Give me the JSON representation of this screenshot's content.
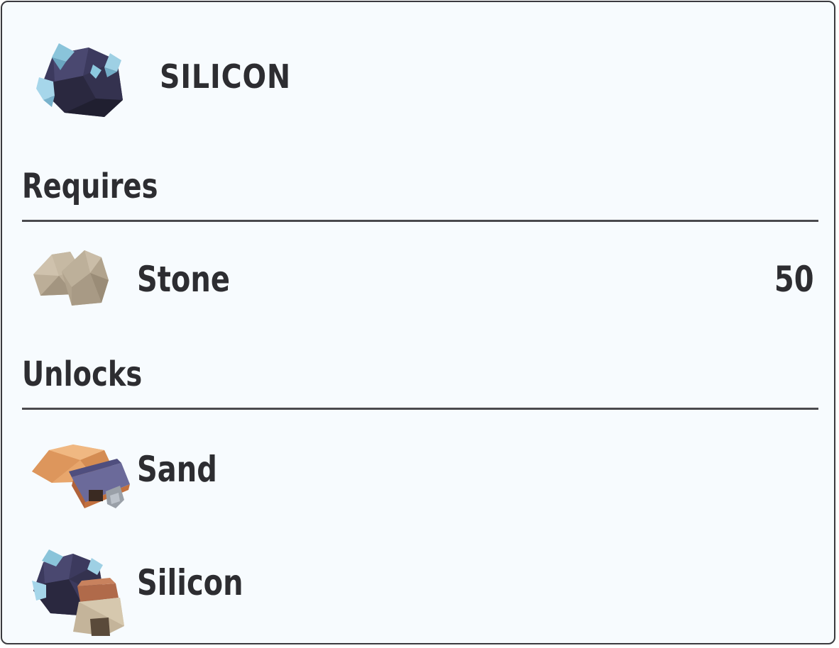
{
  "item": {
    "title": "SILICON",
    "icon": "silicon-ore-icon"
  },
  "requires": {
    "heading": "Requires",
    "items": [
      {
        "name": "Stone",
        "amount": "50",
        "icon": "stone-icon"
      }
    ]
  },
  "unlocks": {
    "heading": "Unlocks",
    "items": [
      {
        "name": "Sand",
        "icon": "sand-mill-icon"
      },
      {
        "name": "Silicon",
        "icon": "silicon-furnace-icon"
      }
    ]
  },
  "colors": {
    "background": "#f7fbfe",
    "border": "#3a3a3e",
    "text": "#2d2d31",
    "divider": "#4a4a4e"
  }
}
